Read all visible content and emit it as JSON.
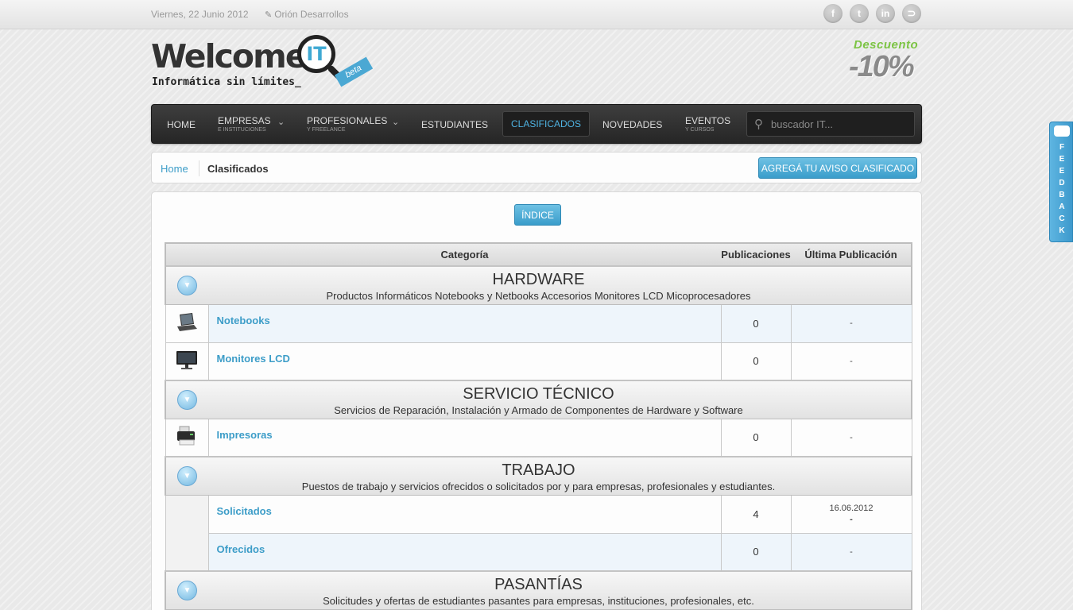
{
  "topbar": {
    "date": "Viernes, 22 Junio 2012",
    "developer": "Orión Desarrollos",
    "social": [
      "f",
      "t",
      "in",
      "rss"
    ]
  },
  "logo": {
    "word": "Welcome",
    "it": "IT",
    "badge": "beta",
    "tagline": "Informática sin límites_"
  },
  "promo": {
    "line1": "Descuento",
    "line2": "-10%"
  },
  "nav": {
    "home": "HOME",
    "empresas": "EMPRESAS",
    "empresas_sub": "E INSTITUCIONES",
    "profesionales": "PROFESIONALES",
    "profesionales_sub": "Y FREELANCE",
    "estudiantes": "ESTUDIANTES",
    "clasificados": "CLASIFICADOS",
    "novedades": "NOVEDADES",
    "eventos": "EVENTOS",
    "eventos_sub": "Y CURSOS",
    "search_placeholder": "buscador IT..."
  },
  "breadcrumb": {
    "home": "Home",
    "current": "Clasificados",
    "action": "AGREGÁ TU AVISO CLASIFICADO"
  },
  "index_button": "ÍNDICE",
  "table": {
    "headers": {
      "category": "Categoría",
      "posts": "Publicaciones",
      "last": "Última Publicación"
    },
    "categories": [
      {
        "name": "HARDWARE",
        "desc": "Productos Informáticos Notebooks y Netbooks Accesorios Monitores LCD Micoprocesadores",
        "items": [
          {
            "name": "Notebooks",
            "posts": "0",
            "last": "-"
          },
          {
            "name": "Monitores LCD",
            "posts": "0",
            "last": "-"
          }
        ]
      },
      {
        "name": "SERVICIO TÉCNICO",
        "desc": "Servicios de Reparación, Instalación y Armado de Componentes de Hardware y Software",
        "items": [
          {
            "name": "Impresoras",
            "posts": "0",
            "last": "-"
          }
        ]
      },
      {
        "name": "TRABAJO",
        "desc": "Puestos de trabajo y servicios ofrecidos o solicitados por y para empresas, profesionales y estudiantes.",
        "items": [
          {
            "name": "Solicitados",
            "posts": "4",
            "last_date": "16.06.2012",
            "last": "-"
          },
          {
            "name": "Ofrecidos",
            "posts": "0",
            "last": "-"
          }
        ]
      },
      {
        "name": "PASANTÍAS",
        "desc": "Solicitudes y ofertas de estudiantes pasantes para empresas, instituciones, profesionales, etc."
      }
    ]
  },
  "feedback": "F\nE\nE\nD\nB\nA\nC\nK",
  "colors": {
    "accent": "#3d9dc8",
    "nav_bg": "#2f2f2f",
    "promo_green": "#7cc444"
  }
}
